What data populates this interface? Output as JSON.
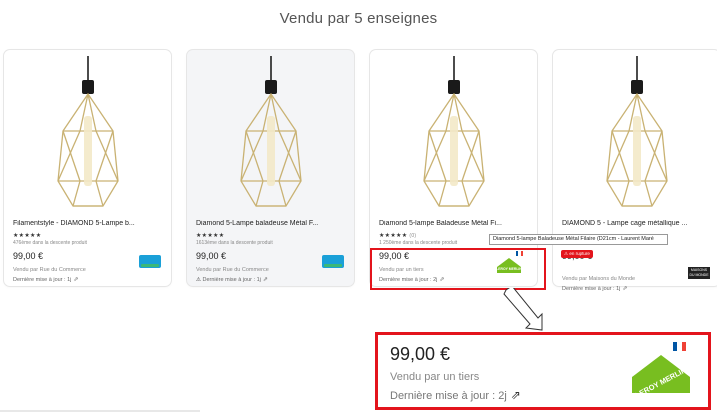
{
  "page": {
    "title": "Vendu par 5 enseignes"
  },
  "cards": [
    {
      "name": "Filamentstyle - DIAMOND 5-Lampe b...",
      "stars": "★★★★★",
      "rating_count": "",
      "rank": "476ème dans la descente produit",
      "price": "99,00 €",
      "seller": "Vendu par Rue du Commerce",
      "updated": "Dernière mise à jour : 1j",
      "logo_text": "RUE DU COMMERCE"
    },
    {
      "name": "Diamond 5-Lampe baladeuse Métal F...",
      "stars": "★★★★★",
      "rating_count": "",
      "rank": "1613ème dans la descente produit",
      "price": "99,00 €",
      "seller": "Vendu par Rue du Commerce",
      "updated": "Dernière mise à jour : 1j",
      "warning_icon": "⚠",
      "logo_text": "RUE DU COMMERCE"
    },
    {
      "name": "Diamond 5-lampe Baladeuse Métal Fi...",
      "stars": "★★★★★",
      "rating_count": "(0)",
      "rank": "1 250ème dans la descente produit",
      "price": "99,00 €",
      "seller": "Vendu par un tiers",
      "updated": "Dernière mise à jour : 2j",
      "logo_text": "LEROY MERLIN"
    },
    {
      "name": "DIAMOND 5 - Lampe cage métallique ...",
      "badge": "en rupture",
      "price": "99,00 €",
      "seller": "Vendu par Maisons du Monde",
      "updated": "Dernière mise à jour : 1j",
      "logo_text": "MAISONS DU MONDE"
    }
  ],
  "tooltip": "Diamond 5-lampe Baladeuse Métal Filaire (D21cm - Laurent Maré",
  "zoom": {
    "price": "99,00 €",
    "seller": "Vendu par un tiers",
    "updated": "Dernière mise à jour : 2j",
    "logo_text": "LEROY MERLIN"
  },
  "icons": {
    "external_link": "⇗",
    "warning": "⚠"
  },
  "colors": {
    "highlight": "#e3141c",
    "leroy_green": "#78be20",
    "rdc_blue": "#1aa0d8",
    "flag_blue": "#0055a4",
    "flag_red": "#ef4135"
  }
}
